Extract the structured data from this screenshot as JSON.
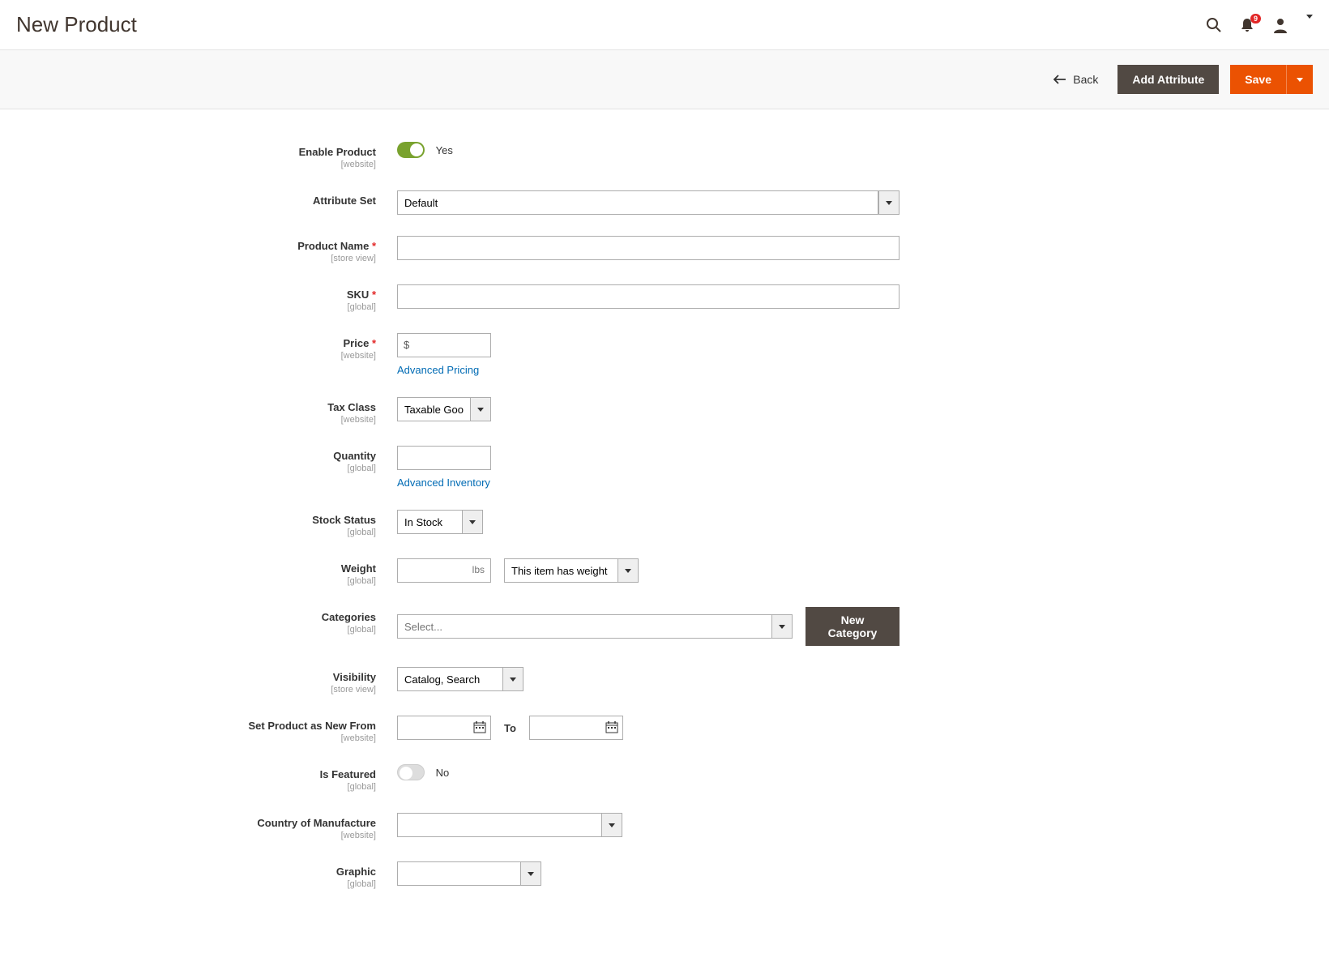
{
  "header": {
    "title": "New Product",
    "notification_count": "9"
  },
  "toolbar": {
    "back": "Back",
    "add_attribute": "Add Attribute",
    "save": "Save"
  },
  "form": {
    "enable_product": {
      "label": "Enable Product",
      "scope": "[website]",
      "value": "Yes"
    },
    "attribute_set": {
      "label": "Attribute Set",
      "value": "Default"
    },
    "product_name": {
      "label": "Product Name",
      "scope": "[store view]",
      "value": ""
    },
    "sku": {
      "label": "SKU",
      "scope": "[global]",
      "value": ""
    },
    "price": {
      "label": "Price",
      "scope": "[website]",
      "currency": "$",
      "value": "",
      "advanced_link": "Advanced Pricing"
    },
    "tax_class": {
      "label": "Tax Class",
      "scope": "[website]",
      "value": "Taxable Goods"
    },
    "quantity": {
      "label": "Quantity",
      "scope": "[global]",
      "value": "",
      "advanced_link": "Advanced Inventory"
    },
    "stock_status": {
      "label": "Stock Status",
      "scope": "[global]",
      "value": "In Stock"
    },
    "weight": {
      "label": "Weight",
      "scope": "[global]",
      "unit": "lbs",
      "value": "",
      "has_weight": "This item has weight"
    },
    "categories": {
      "label": "Categories",
      "scope": "[global]",
      "placeholder": "Select...",
      "new_button": "New Category"
    },
    "visibility": {
      "label": "Visibility",
      "scope": "[store view]",
      "value": "Catalog, Search"
    },
    "new_from": {
      "label": "Set Product as New From",
      "scope": "[website]",
      "to_label": "To",
      "from_value": "",
      "to_value": ""
    },
    "is_featured": {
      "label": "Is Featured",
      "scope": "[global]",
      "value": "No"
    },
    "country": {
      "label": "Country of Manufacture",
      "scope": "[website]",
      "value": ""
    },
    "graphic": {
      "label": "Graphic",
      "scope": "[global]",
      "value": ""
    }
  }
}
